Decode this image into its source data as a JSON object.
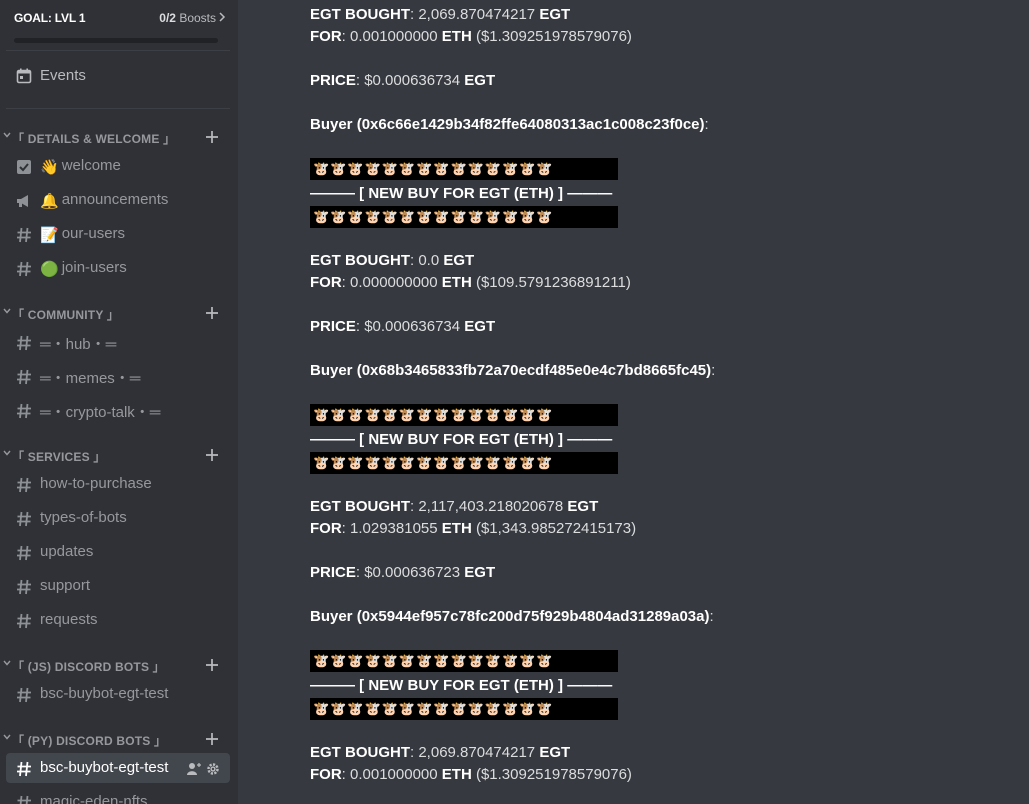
{
  "sidebar": {
    "goal": {
      "title": "GOAL: LVL 1",
      "boosts_count": "0/2",
      "boosts_label": "Boosts"
    },
    "events_label": "Events",
    "categories": [
      {
        "name": "「 DETAILS & WELCOME 」",
        "channels": [
          {
            "emoji": "👋",
            "label": "welcome",
            "icon": "checkbox-channel-icon"
          },
          {
            "emoji": "🔔",
            "label": "announcements",
            "icon": "megaphone-icon"
          },
          {
            "emoji": "📝",
            "label": "our-users",
            "icon": "hashtag-icon"
          },
          {
            "emoji": "🟢",
            "label": "join-users",
            "icon": "hashtag-icon"
          }
        ]
      },
      {
        "name": "「 COMMUNITY 」",
        "channels": [
          {
            "label": "═・hub・═",
            "icon": "hashtag-icon"
          },
          {
            "label": "═・memes・═",
            "icon": "hashtag-icon"
          },
          {
            "label": "═・crypto-talk・═",
            "icon": "hashtag-icon"
          }
        ]
      },
      {
        "name": "「 SERVICES 」",
        "channels": [
          {
            "label": "how-to-purchase",
            "icon": "hashtag-icon"
          },
          {
            "label": "types-of-bots",
            "icon": "hashtag-icon"
          },
          {
            "label": "updates",
            "icon": "hashtag-icon"
          },
          {
            "label": "support",
            "icon": "hashtag-icon"
          },
          {
            "label": "requests",
            "icon": "hashtag-icon"
          }
        ]
      },
      {
        "name": "「 (JS) DISCORD BOTS 」",
        "channels": [
          {
            "label": "bsc-buybot-egt-test",
            "icon": "hashtag-icon"
          }
        ]
      },
      {
        "name": "「 (PY) DISCORD BOTS 」",
        "channels": [
          {
            "label": "bsc-buybot-egt-test",
            "icon": "hashtag-icon",
            "active": true
          },
          {
            "label": "magic-eden-nfts",
            "icon": "hashtag-icon"
          }
        ]
      }
    ]
  },
  "messages": {
    "banner_emojis": "🐮🐮🐮🐮🐮🐮🐮🐮🐮🐮🐮🐮🐮🐮",
    "banner_title": "——— [ NEW BUY FOR EGT (ETH) ] ———",
    "labels": {
      "bought": "EGT BOUGHT",
      "for": "FOR",
      "price": "PRICE",
      "buyer": "Buyer",
      "egt": "EGT",
      "eth": "ETH"
    },
    "top": {
      "bought": "2,069.870474217",
      "for_eth": "0.001000000",
      "for_usd": "($1.309251978579076)",
      "price": "$0.000636734",
      "buyer": "(0x6c66e1429b34f82ffe64080313ac1c008c23f0ce)"
    },
    "buys": [
      {
        "bought": "0.0",
        "for_eth": "0.000000000",
        "for_usd": "($109.5791236891211)",
        "price": "$0.000636734",
        "buyer": "(0x68b3465833fb72a70ecdf485e0e4c7bd8665fc45)"
      },
      {
        "bought": "2,117,403.218020678",
        "for_eth": "1.029381055",
        "for_usd": "($1,343.985272415173)",
        "price": "$0.000636723",
        "buyer": "(0x5944ef957c78fc200d75f929b4804ad31289a03a)"
      },
      {
        "bought": "2,069.870474217",
        "for_eth": "0.001000000",
        "for_usd": "($1.309251978579076)"
      }
    ]
  },
  "colors": {
    "sidebar_bg": "#2f3136",
    "main_bg": "#36393f",
    "active_channel_bg": "#42464d",
    "muted_text": "#96989d",
    "banner_bg": "#000000"
  }
}
